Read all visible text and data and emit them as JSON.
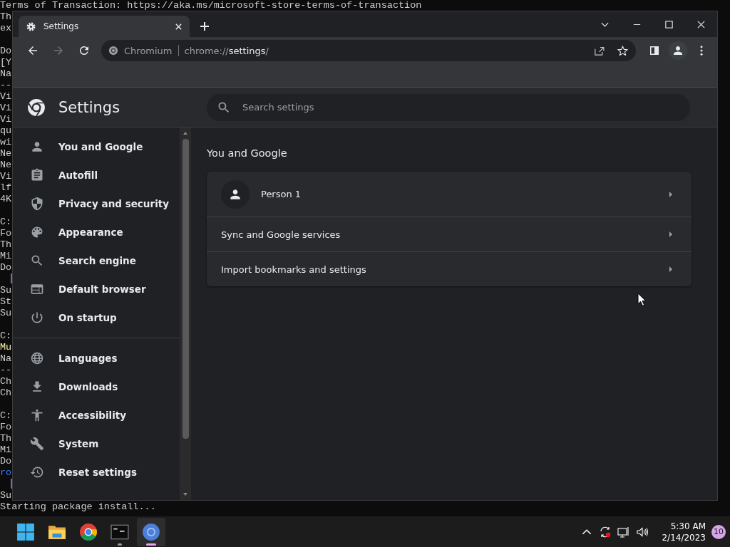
{
  "terminal": {
    "blocks": [
      [
        {
          "text": "Terms of Transaction: https://aka.ms/microsoft-store-terms-of-transaction",
          "color": "#cccccc"
        },
        {
          "text": "Th",
          "color": "#cccccc"
        },
        {
          "text": "ex",
          "color": "#cccccc"
        }
      ],
      [
        {
          "text": "Do",
          "color": "#cccccc"
        },
        {
          "text": "[Y",
          "color": "#cccccc"
        },
        {
          "text": "Na",
          "color": "#cccccc"
        },
        {
          "text": "--"
        },
        {
          "text": "Vi",
          "color": "#cccccc"
        },
        {
          "text": "Vi",
          "color": "#cccccc"
        },
        {
          "text": "Vi",
          "color": "#cccccc"
        },
        {
          "text": "qu",
          "color": "#cccccc"
        },
        {
          "text": "wi",
          "color": "#cccccc"
        },
        {
          "text": "Ne",
          "color": "#cccccc"
        },
        {
          "text": "Ne",
          "color": "#cccccc"
        },
        {
          "text": "Vi",
          "color": "#cccccc"
        },
        {
          "text": "lf",
          "color": "#cccccc"
        },
        {
          "text": "4K",
          "color": "#cccccc"
        }
      ],
      [
        {
          "text": "C:",
          "color": "#cccccc"
        },
        {
          "text": "Fo",
          "color": "#cccccc"
        },
        {
          "text": "Th",
          "color": "#cccccc"
        },
        {
          "text": "Mi",
          "color": "#cccccc"
        },
        {
          "text": "Do",
          "color": "#cccccc"
        },
        {
          "kind": "progress",
          "color": "#8a5cc4"
        },
        {
          "text": "Su",
          "color": "#cccccc"
        },
        {
          "text": "St",
          "color": "#cccccc"
        },
        {
          "text": "Su",
          "color": "#cccccc"
        }
      ],
      [
        {
          "text": "C:",
          "color": "#cccccc"
        },
        {
          "text": "Mu",
          "color": "#f9f1a5"
        },
        {
          "text": "Na",
          "color": "#cccccc"
        },
        {
          "text": "--"
        },
        {
          "text": "Ch",
          "color": "#cccccc"
        },
        {
          "text": "Ch",
          "color": "#cccccc"
        }
      ],
      [
        {
          "text": "C:",
          "color": "#cccccc"
        },
        {
          "text": "Fo",
          "color": "#cccccc"
        },
        {
          "text": "Th",
          "color": "#cccccc"
        },
        {
          "text": "Mi",
          "color": "#cccccc"
        },
        {
          "text": "Do",
          "color": "#cccccc"
        },
        {
          "text": "ro",
          "color": "#3b78ff"
        },
        {
          "kind": "progress",
          "color": "#8a5cc4"
        },
        {
          "text": "Su",
          "color": "#cccccc"
        },
        {
          "text": "Starting package install...",
          "color": "#cccccc"
        }
      ]
    ]
  },
  "browser": {
    "tab": {
      "title": "Settings",
      "selected": true
    },
    "address": {
      "site": "Chromium",
      "scheme": "chrome://",
      "host": "settings",
      "rest": "/"
    },
    "settings": {
      "title": "Settings",
      "search": {
        "placeholder": "Search settings"
      },
      "nav": [
        [
          {
            "label": "You and Google"
          },
          {
            "label": "Autofill"
          },
          {
            "label": "Privacy and security"
          },
          {
            "label": "Appearance"
          },
          {
            "label": "Search engine"
          },
          {
            "label": "Default browser"
          },
          {
            "label": "On startup"
          }
        ],
        [
          {
            "label": "Languages"
          },
          {
            "label": "Downloads"
          },
          {
            "label": "Accessibility"
          },
          {
            "label": "System"
          },
          {
            "label": "Reset settings"
          }
        ]
      ],
      "section_title": "You and Google",
      "rows": [
        {
          "kind": "profile",
          "label": "Person 1"
        },
        {
          "kind": "link",
          "label": "Sync and Google services"
        },
        {
          "kind": "link",
          "label": "Import bookmarks and settings"
        }
      ]
    }
  },
  "taskbar": {
    "apps": [
      {
        "active": false,
        "running": false
      },
      {
        "active": false,
        "running": false
      },
      {
        "active": false,
        "running": false
      },
      {
        "active": false,
        "running": true
      },
      {
        "active": true,
        "running": true
      }
    ],
    "time": "5:30 AM",
    "date": "2/14/2023",
    "notifications": "10"
  }
}
